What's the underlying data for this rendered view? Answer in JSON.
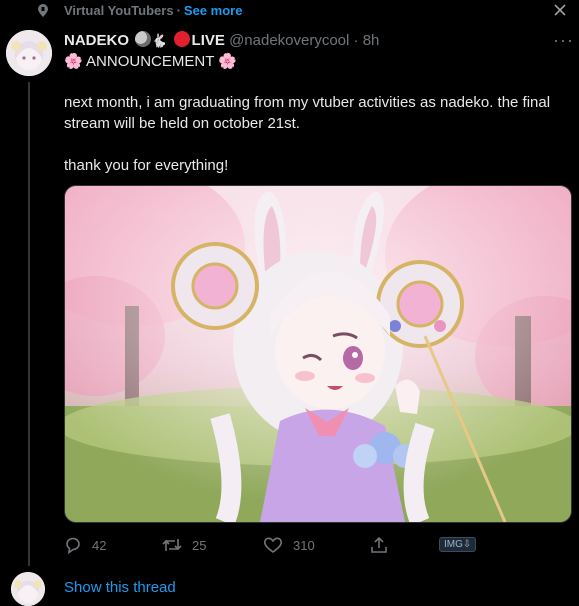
{
  "topic": {
    "name": "Virtual YouTubers",
    "separator": "·",
    "see_more": "See more"
  },
  "tweet": {
    "display_name": "NADEKO",
    "live_label": "LIVE",
    "handle": "@nadekoverycool",
    "separator": "·",
    "time": "8h",
    "announcement": "ANNOUNCEMENT",
    "paragraph1": "next month, i am graduating from my vtuber activities as nadeko. the final stream will be held on october 21st.",
    "paragraph2": "thank you for everything!"
  },
  "actions": {
    "replies": "42",
    "retweets": "25",
    "likes": "310",
    "img_badge": "IMG⇩"
  },
  "show_thread": "Show this thread",
  "colors": {
    "background": "#000000",
    "text": "#e7e9ea",
    "muted": "#71767b",
    "accent": "#1d9bf0",
    "live_dot": "#e0202f"
  }
}
